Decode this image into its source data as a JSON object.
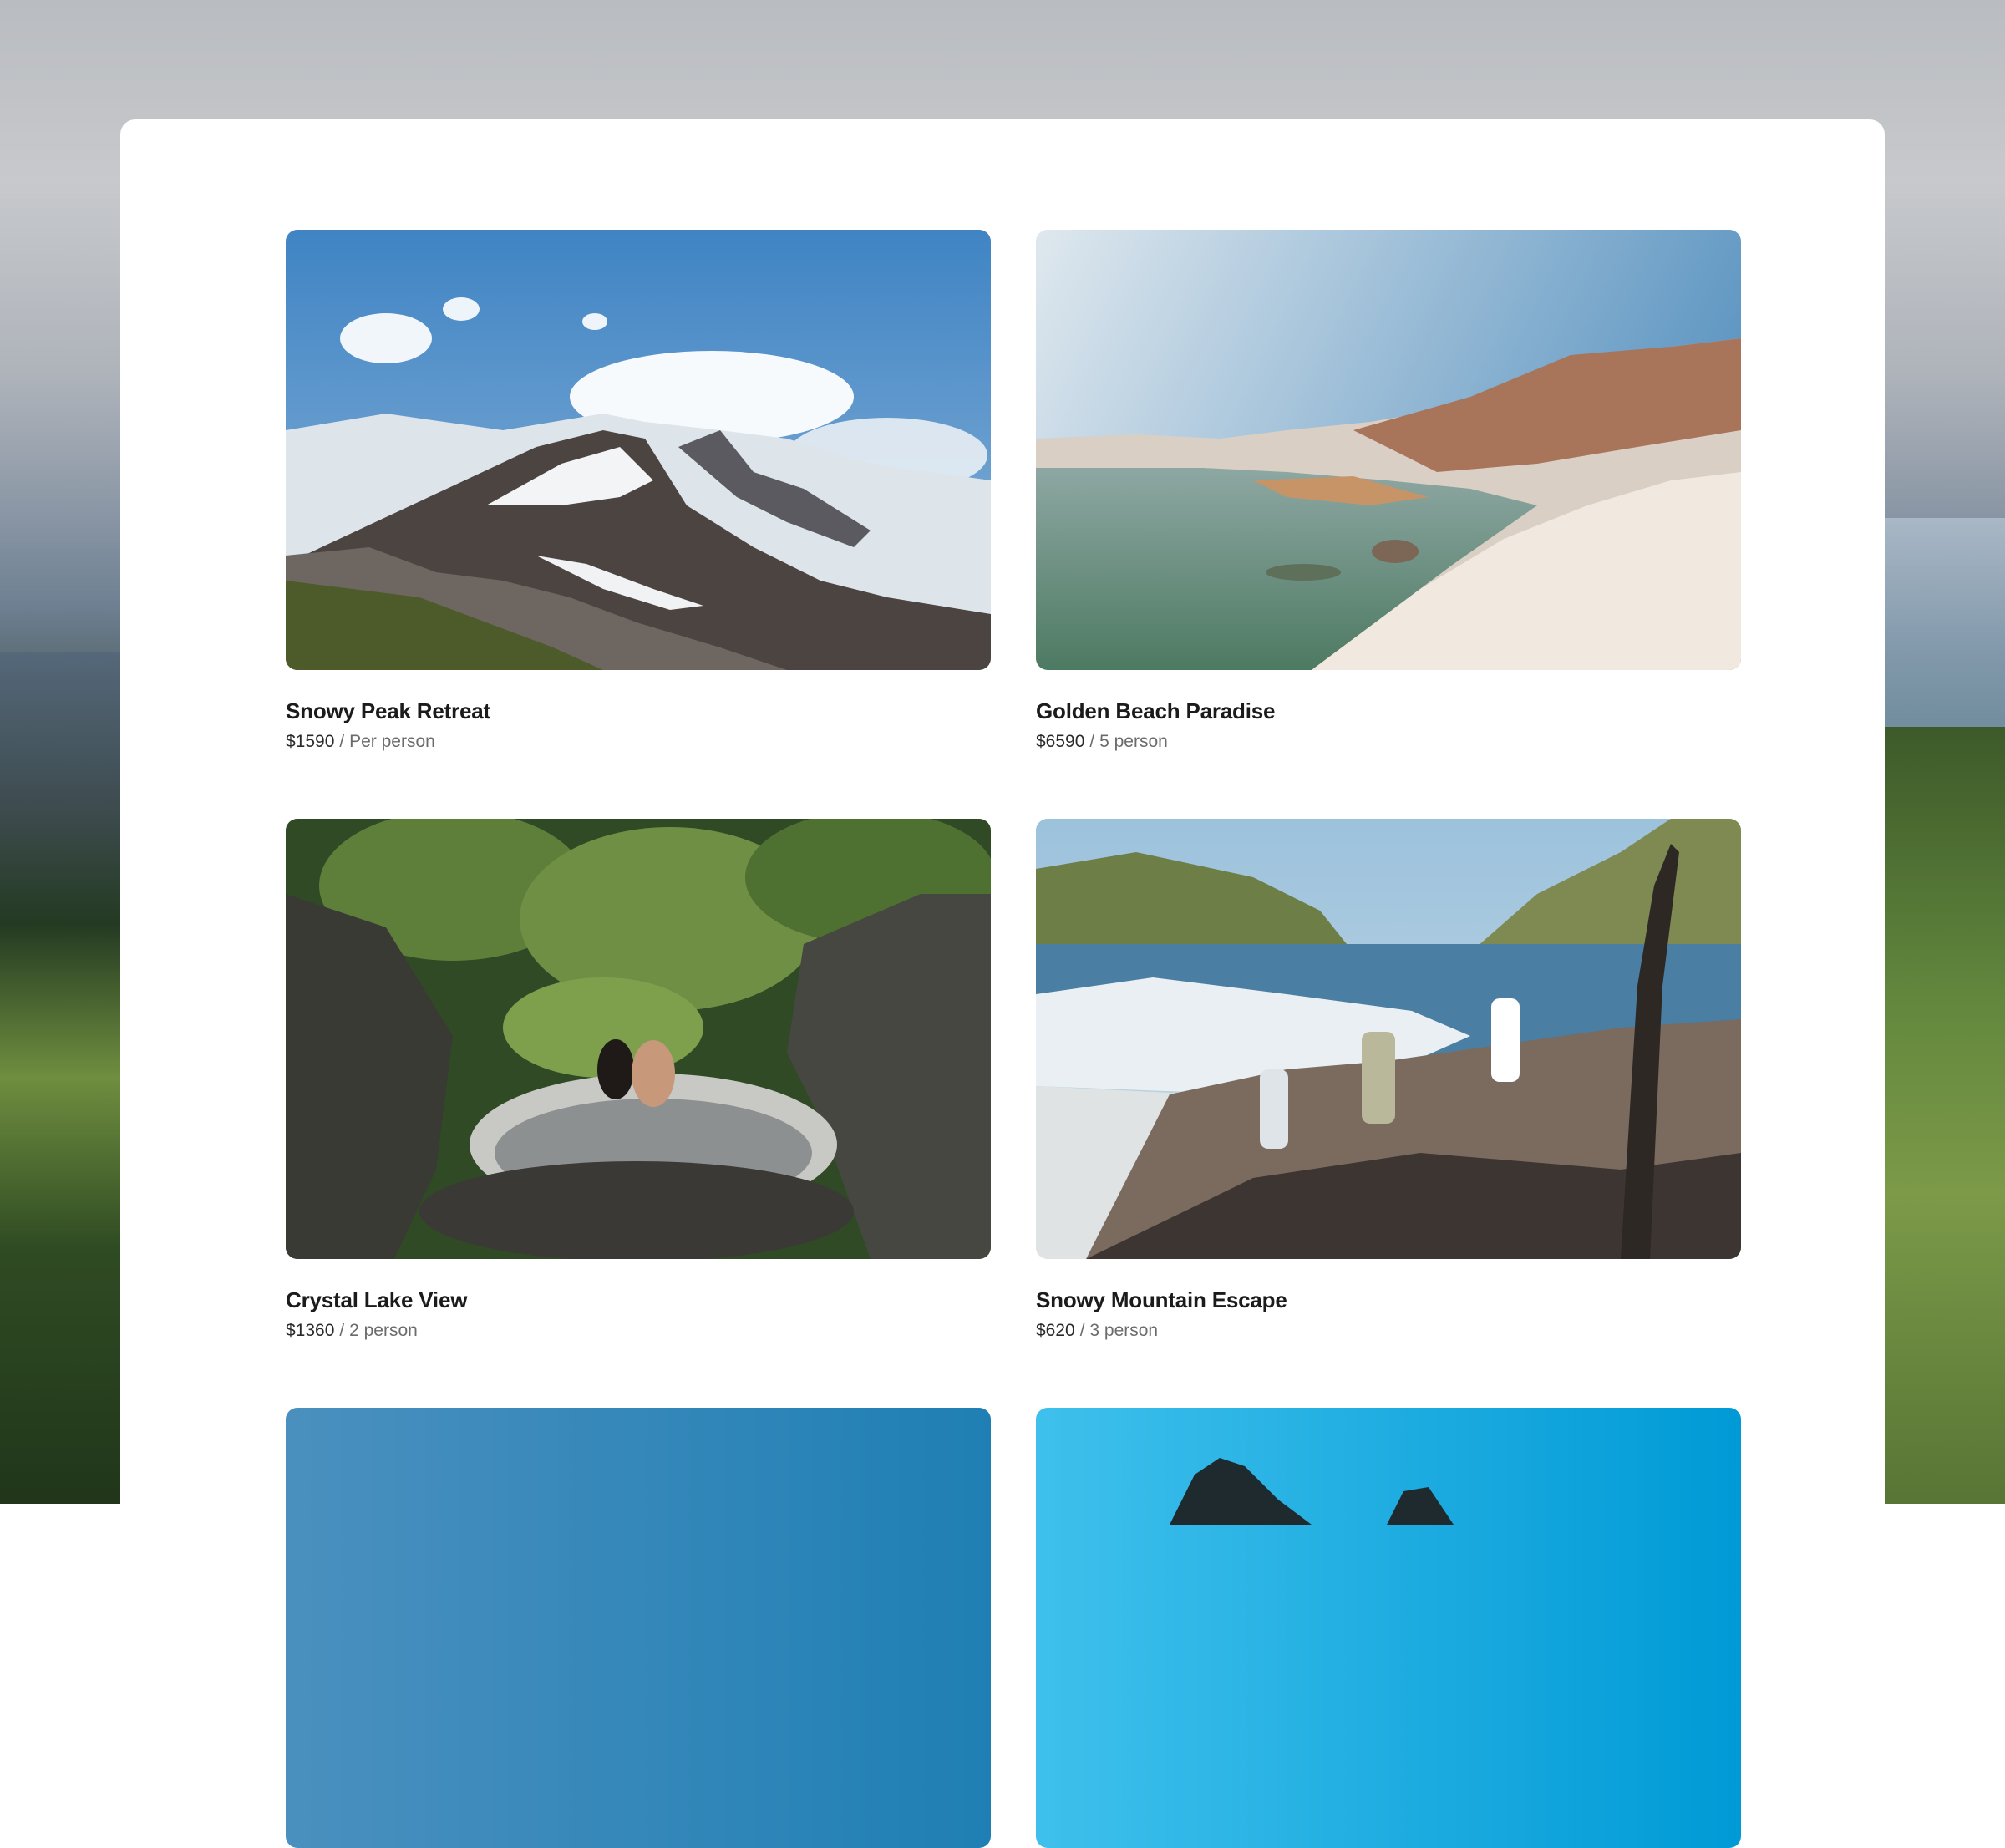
{
  "listings": [
    {
      "title": "Snowy Peak Retreat",
      "price": "$1590",
      "unit": "/ Per person",
      "image": "snowy-mountain-photo"
    },
    {
      "title": "Golden Beach Paradise",
      "price": "$6590",
      "unit": "/ 5 person",
      "image": "white-cliff-coast-photo"
    },
    {
      "title": "Crystal Lake View",
      "price": "$1360",
      "unit": "/ 2 person",
      "image": "jungle-pool-photo"
    },
    {
      "title": "Snowy Mountain Escape",
      "price": "$620",
      "unit": "/ 3 person",
      "image": "rocky-beach-hikers-photo"
    },
    {
      "image": "blue-sky-photo"
    },
    {
      "image": "cyan-sky-peaks-photo"
    }
  ],
  "colors": {
    "panel": "#ffffff",
    "title_text": "#1b1b1b",
    "muted_text": "#6b6b6b"
  }
}
